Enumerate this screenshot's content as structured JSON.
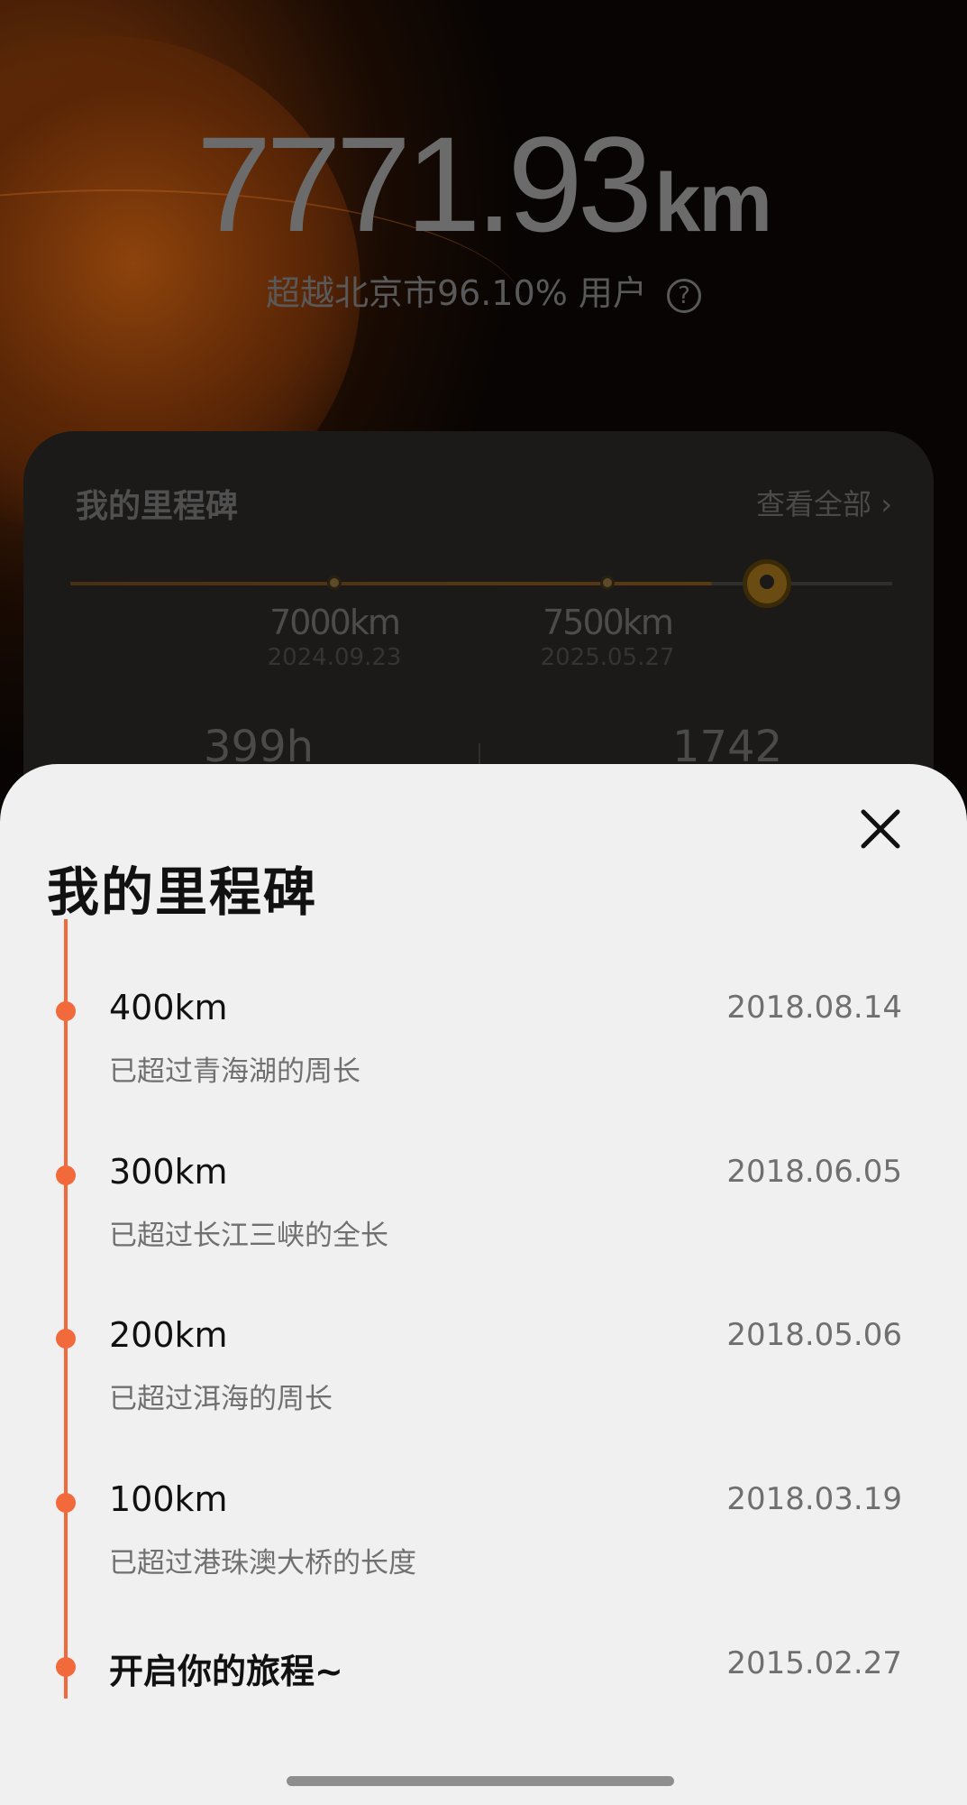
{
  "summary": {
    "total_distance": "7771.93",
    "unit": "km",
    "rank_text": "超越北京市96.10% 用户",
    "help_icon": "question-circle-icon"
  },
  "milestone_card": {
    "title": "我的里程碑",
    "view_all": "查看全部 ›",
    "marks": [
      {
        "km": "7000km",
        "date": "2024.09.23"
      },
      {
        "km": "7500km",
        "date": "2025.05.27"
      }
    ],
    "stat_left": "399h",
    "stat_right": "1742"
  },
  "sheet": {
    "title": "我的里程碑",
    "close_icon": "close-icon",
    "accent_color": "#f26a3c",
    "milestones": [
      {
        "title": "400km",
        "date": "2018.08.14",
        "desc": "已超过青海湖的周长"
      },
      {
        "title": "300km",
        "date": "2018.06.05",
        "desc": "已超过长江三峡的全长"
      },
      {
        "title": "200km",
        "date": "2018.05.06",
        "desc": "已超过洱海的周长"
      },
      {
        "title": "100km",
        "date": "2018.03.19",
        "desc": "已超过港珠澳大桥的长度"
      },
      {
        "title": "开启你的旅程~",
        "date": "2015.02.27",
        "desc": ""
      }
    ]
  }
}
